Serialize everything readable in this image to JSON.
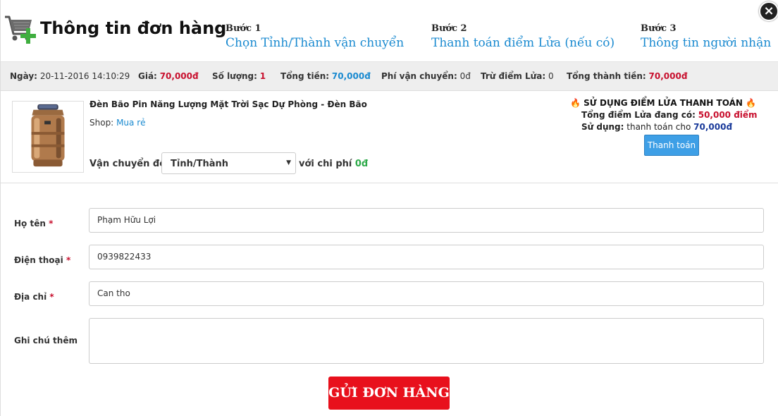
{
  "header": {
    "title": "Thông tin đơn hàng",
    "steps": [
      {
        "label": "Bước 1",
        "text": "Chọn Tỉnh/Thành vận chuyển"
      },
      {
        "label": "Bước 2",
        "text": "Thanh toán điểm Lửa (nếu có)"
      },
      {
        "label": "Bước 3",
        "text": "Thông tin người nhận"
      }
    ],
    "close": "×"
  },
  "summary": {
    "date_label": "Ngày:",
    "date_value": "20-11-2016 14:10:29",
    "price_label": "Giá:",
    "price_value": "70,000đ",
    "qty_label": "Số lượng:",
    "qty_value": "1",
    "total_label": "Tổng tiền:",
    "total_value": "70,000đ",
    "ship_label": "Phí vận chuyển:",
    "ship_value": "0đ",
    "points_label": "Trừ điểm Lửa:",
    "points_value": "0",
    "grand_label": "Tổng thành tiền:",
    "grand_value": "70,000đ"
  },
  "product": {
    "name": "Đèn Bão Pin Năng Lượng Mặt Trời Sạc Dự Phòng - Đèn Bão",
    "shop_label": "Shop:",
    "shop_name": "Mua rẻ",
    "ship_to_label": "Vận chuyển đến",
    "ship_select_value": "Tỉnh/Thành",
    "ship_cost_label": "với chi phí",
    "ship_cost_value": "0đ"
  },
  "points": {
    "title": "SỬ DỤNG ĐIỂM LỬA THANH TOÁN",
    "have_label": "Tổng điểm Lửa đang có:",
    "have_value": "50,000 điểm",
    "use_label": "Sử dụng:",
    "use_text": "thanh toán cho",
    "use_value": "70,000đ",
    "pay_button": "Thanh toán"
  },
  "form": {
    "name_label": "Họ tên",
    "name_value": "Phạm Hữu Lợi",
    "phone_label": "Điện thoại",
    "phone_value": "0939822433",
    "address_label": "Địa chỉ",
    "address_value": "Can tho",
    "note_label": "Ghi chú thêm",
    "note_value": "",
    "required_mark": "*"
  },
  "submit_label": "GỬI ĐƠN HÀNG",
  "colors": {
    "accent_blue": "#1a8ad0",
    "price_red": "#c8102e",
    "submit_red": "#e8101c",
    "pay_button": "#3e9fe6",
    "cost_green": "#2eaa4a"
  }
}
